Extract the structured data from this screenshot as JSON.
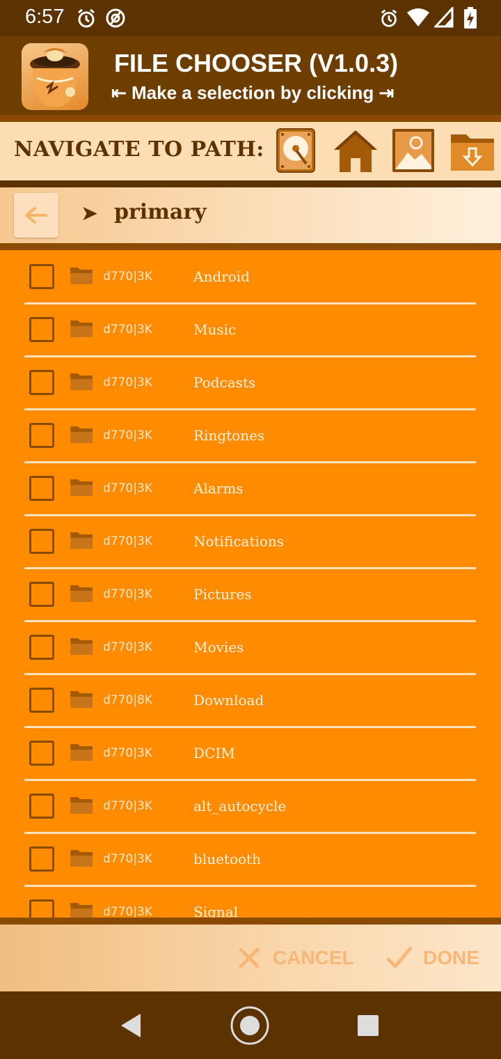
{
  "status": {
    "time": "6:57"
  },
  "header": {
    "title": "FILE CHOOSER (V1.0.3)",
    "subtitle": "⇤ Make a selection by clicking ⇥"
  },
  "nav": {
    "label": "NAVIGATE TO PATH:",
    "buttons": [
      "storage-icon",
      "home-icon",
      "pictures-icon",
      "download-folder-icon"
    ]
  },
  "path": {
    "arrow": "➤",
    "current": "primary"
  },
  "files": [
    {
      "meta": "d770|3K",
      "name": "Android"
    },
    {
      "meta": "d770|3K",
      "name": "Music"
    },
    {
      "meta": "d770|3K",
      "name": "Podcasts"
    },
    {
      "meta": "d770|3K",
      "name": "Ringtones"
    },
    {
      "meta": "d770|3K",
      "name": "Alarms"
    },
    {
      "meta": "d770|3K",
      "name": "Notifications"
    },
    {
      "meta": "d770|3K",
      "name": "Pictures"
    },
    {
      "meta": "d770|3K",
      "name": "Movies"
    },
    {
      "meta": "d770|8K",
      "name": "Download"
    },
    {
      "meta": "d770|3K",
      "name": "DCIM"
    },
    {
      "meta": "d770|3K",
      "name": "alt_autocycle"
    },
    {
      "meta": "d770|3K",
      "name": "bluetooth"
    },
    {
      "meta": "d770|3K",
      "name": "Signal"
    }
  ],
  "actions": {
    "cancel": "CANCEL",
    "done": "DONE"
  },
  "colors": {
    "list_bg": "#FF8C00",
    "dark_brown": "#5C3300",
    "header_brown": "#6E3D00"
  }
}
